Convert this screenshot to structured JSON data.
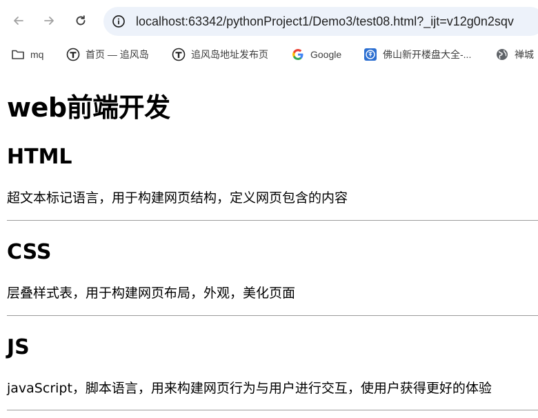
{
  "browser": {
    "url": "localhost:63342/pythonProject1/Demo3/test08.html?_ijt=v12g0n2sqv"
  },
  "bookmarks": [
    {
      "label": "mq",
      "icon": "folder-icon"
    },
    {
      "label": "首页 — 追风岛",
      "icon": "site-t-icon"
    },
    {
      "label": "追风岛地址发布页",
      "icon": "site-t-icon"
    },
    {
      "label": "Google",
      "icon": "google-icon"
    },
    {
      "label": "佛山新开楼盘大全-...",
      "icon": "fang-icon"
    },
    {
      "label": "禅城",
      "icon": "globe-icon"
    }
  ],
  "page": {
    "title": "web前端开发",
    "sections": [
      {
        "heading": "HTML",
        "text": "超文本标记语言，用于构建网页结构，定义网页包含的内容"
      },
      {
        "heading": "CSS",
        "text": "层叠样式表，用于构建网页布局，外观，美化页面"
      },
      {
        "heading": "JS",
        "text": "javaScript，脚本语言，用来构建网页行为与用户进行交互，使用户获得更好的体验"
      }
    ]
  },
  "colors": {
    "omnibox": "#edf2fa",
    "divider": "#9a9a9a",
    "text": "#000000"
  }
}
